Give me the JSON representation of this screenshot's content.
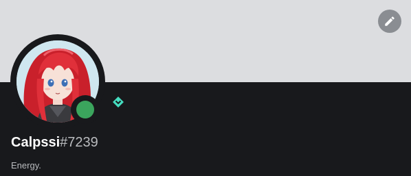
{
  "profile": {
    "username": "Calpssi",
    "discriminator": "#7239",
    "about": "Energy.",
    "status": "online",
    "badge_icon": "hypesquad-balance-icon",
    "edit_icon": "pencil-icon"
  },
  "colors": {
    "banner": "#dcdde0",
    "card_background": "#18191c",
    "status_online": "#3ba55d",
    "badge": "#45ddc0",
    "edit_button": "#8a8d92"
  }
}
